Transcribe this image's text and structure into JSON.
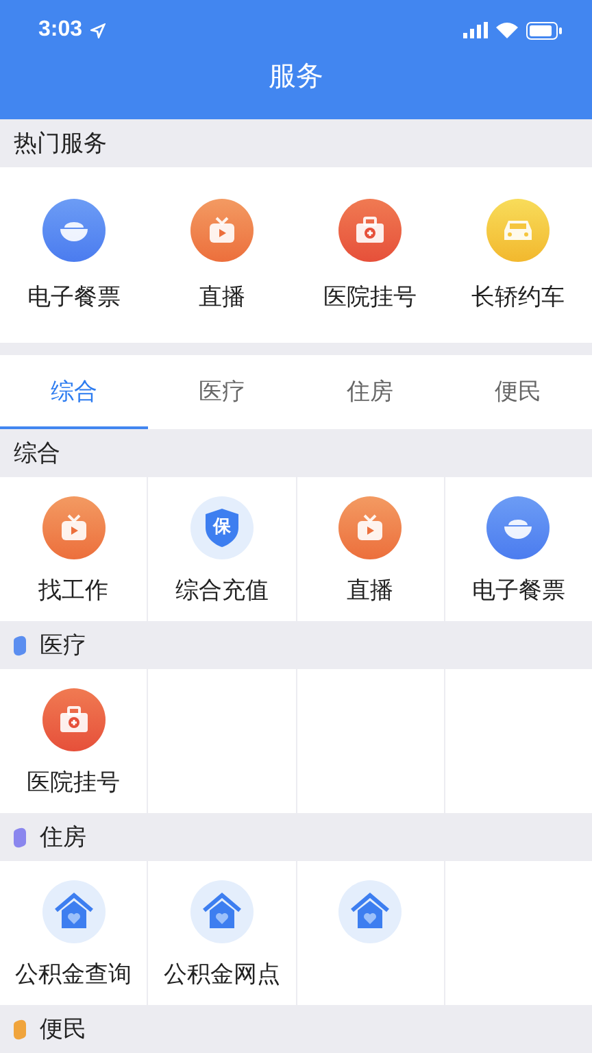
{
  "status_bar": {
    "time": "3:03"
  },
  "header": {
    "title": "服务"
  },
  "hot": {
    "title": "热门服务",
    "items": [
      {
        "label": "电子餐票",
        "kind": "bowl"
      },
      {
        "label": "直播",
        "kind": "tv"
      },
      {
        "label": "医院挂号",
        "kind": "medkit"
      },
      {
        "label": "长轿约车",
        "kind": "car"
      }
    ]
  },
  "tabs": [
    {
      "label": "综合",
      "selected": true
    },
    {
      "label": "医疗",
      "selected": false
    },
    {
      "label": "住房",
      "selected": false
    },
    {
      "label": "便民",
      "selected": false
    }
  ],
  "sections": [
    {
      "title": "综合",
      "items": [
        {
          "label": "找工作",
          "kind": "tv"
        },
        {
          "label": "综合充值",
          "kind": "shield",
          "icon_text": "保"
        },
        {
          "label": "直播",
          "kind": "tv"
        },
        {
          "label": "电子餐票",
          "kind": "bowl"
        }
      ]
    },
    {
      "title": "医疗",
      "color": "#5b8ef0",
      "items": [
        {
          "label": "医院挂号",
          "kind": "medkit"
        }
      ]
    },
    {
      "title": "住房",
      "color": "#8a86ee",
      "items": [
        {
          "label": "公积金查询",
          "kind": "house"
        },
        {
          "label": "公积金网点",
          "kind": "house"
        },
        {
          "kind": "house"
        }
      ]
    },
    {
      "title": "便民",
      "color": "#f0a43c"
    }
  ]
}
